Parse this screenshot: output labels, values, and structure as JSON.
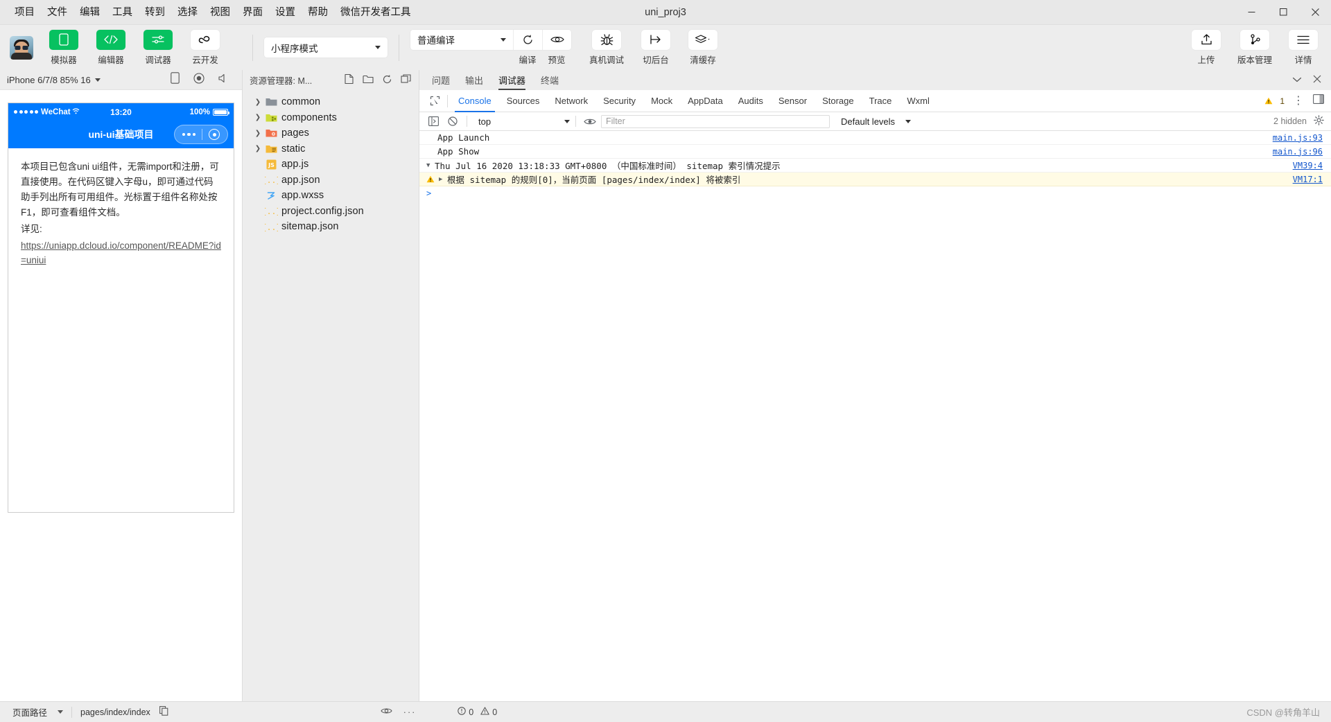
{
  "window": {
    "title": "uni_proj3",
    "menu": [
      "项目",
      "文件",
      "编辑",
      "工具",
      "转到",
      "选择",
      "视图",
      "界面",
      "设置",
      "帮助",
      "微信开发者工具"
    ],
    "controls": {
      "minimize": "minimize-icon",
      "maximize": "maximize-icon",
      "close": "close-icon"
    }
  },
  "toolbar": {
    "avatar_name": "user-avatar",
    "modes": [
      {
        "icon": "phone-icon",
        "label": "模拟器",
        "accent": "#07c160"
      },
      {
        "icon": "code-icon",
        "label": "编辑器",
        "accent": "#07c160"
      },
      {
        "icon": "sliders-icon",
        "label": "调试器",
        "accent": "#07c160"
      },
      {
        "icon": "cloud-icon",
        "label": "云开发",
        "accent": "#ffffff"
      }
    ],
    "project_mode": {
      "value": "小程序模式",
      "name": "project-mode-select"
    },
    "compile_mode": {
      "value": "普通编译",
      "name": "compile-mode-select"
    },
    "compile_label": "编译",
    "preview_label": "预览",
    "actions": [
      {
        "icon": "bug-icon",
        "label": "真机调试"
      },
      {
        "icon": "background-icon",
        "label": "切后台"
      },
      {
        "icon": "layers-icon",
        "label": "清缓存",
        "has_caret": true
      }
    ],
    "right_actions": [
      {
        "icon": "upload-icon",
        "label": "上传"
      },
      {
        "icon": "branch-icon",
        "label": "版本管理"
      },
      {
        "icon": "menu-icon",
        "label": "详情"
      }
    ]
  },
  "simulator": {
    "device": "iPhone 6/7/8 85% 16",
    "head_icons": [
      "rotate-device-icon",
      "record-icon",
      "volume-icon"
    ],
    "status": {
      "carrier": "WeChat",
      "time": "13:20",
      "battery": "100%"
    },
    "nav_title": "uni-ui基础项目",
    "content": {
      "paragraph": "本项目已包含uni ui组件，无需import和注册，可直接使用。在代码区键入字母u，即可通过代码助手列出所有可用组件。光标置于组件名称处按F1，即可查看组件文档。",
      "detail_label": "详见:",
      "link": "https://uniapp.dcloud.io/component/README?id=uniui"
    }
  },
  "explorer": {
    "title": "资源管理器: M...",
    "head_icons": [
      "new-file-icon",
      "new-folder-icon",
      "refresh-icon",
      "collapse-icon"
    ],
    "items": [
      {
        "name": "common",
        "type": "folder",
        "icon_color": "#8a9199",
        "expandable": true
      },
      {
        "name": "components",
        "type": "folder",
        "icon_color": "#c3d045",
        "expandable": true
      },
      {
        "name": "pages",
        "type": "folder",
        "icon_color": "#f2704a",
        "expandable": true
      },
      {
        "name": "static",
        "type": "folder",
        "icon_color": "#f5ba3a",
        "expandable": true
      },
      {
        "name": "app.js",
        "type": "js",
        "icon_color": "#f5ba3a",
        "expandable": false
      },
      {
        "name": "app.json",
        "type": "json",
        "icon_color": "#f5ba3a",
        "expandable": false
      },
      {
        "name": "app.wxss",
        "type": "wxss",
        "icon_color": "#42a5f5",
        "expandable": false
      },
      {
        "name": "project.config.json",
        "type": "json",
        "icon_color": "#f5ba3a",
        "expandable": false
      },
      {
        "name": "sitemap.json",
        "type": "json",
        "icon_color": "#f5ba3a",
        "expandable": false
      }
    ]
  },
  "devtools": {
    "panel_tabs": [
      {
        "label": "问题",
        "active": false
      },
      {
        "label": "输出",
        "active": false
      },
      {
        "label": "调试器",
        "active": true
      },
      {
        "label": "终端",
        "active": false
      }
    ],
    "panel_right_icons": [
      "chevron-down-icon",
      "close-icon"
    ],
    "chrome_tabs": [
      {
        "label": "Console",
        "active": true
      },
      {
        "label": "Sources",
        "active": false
      },
      {
        "label": "Network",
        "active": false
      },
      {
        "label": "Security",
        "active": false
      },
      {
        "label": "Mock",
        "active": false
      },
      {
        "label": "AppData",
        "active": false
      },
      {
        "label": "Audits",
        "active": false
      },
      {
        "label": "Sensor",
        "active": false
      },
      {
        "label": "Storage",
        "active": false
      },
      {
        "label": "Trace",
        "active": false
      },
      {
        "label": "Wxml",
        "active": false
      }
    ],
    "warning_count": "1",
    "console_bar": {
      "context": "top",
      "filter_placeholder": "Filter",
      "levels": "Default levels",
      "hidden_label": "2 hidden"
    },
    "logs": [
      {
        "kind": "plain",
        "text": "App Launch",
        "source": "main.js:93"
      },
      {
        "kind": "plain",
        "text": "App Show",
        "source": "main.js:96"
      },
      {
        "kind": "group",
        "text": "Thu Jul 16 2020 13:18:33 GMT+0800 （中国标准时间） sitemap 索引情况提示",
        "source": "VM39:4"
      },
      {
        "kind": "warning",
        "text": "根据 sitemap 的规则[0]，当前页面 [pages/index/index] 将被索引",
        "source": "VM17:1"
      }
    ],
    "prompt": ">"
  },
  "statusbar": {
    "page_path_label": "页面路径",
    "page_path_value": "pages/index/index",
    "copy_icon": "copy-icon",
    "eye_icon": "eye-icon",
    "more_icon": "more-icon",
    "error_count": "0",
    "warning_count": "0",
    "watermark": "CSDN @转角羊山"
  }
}
